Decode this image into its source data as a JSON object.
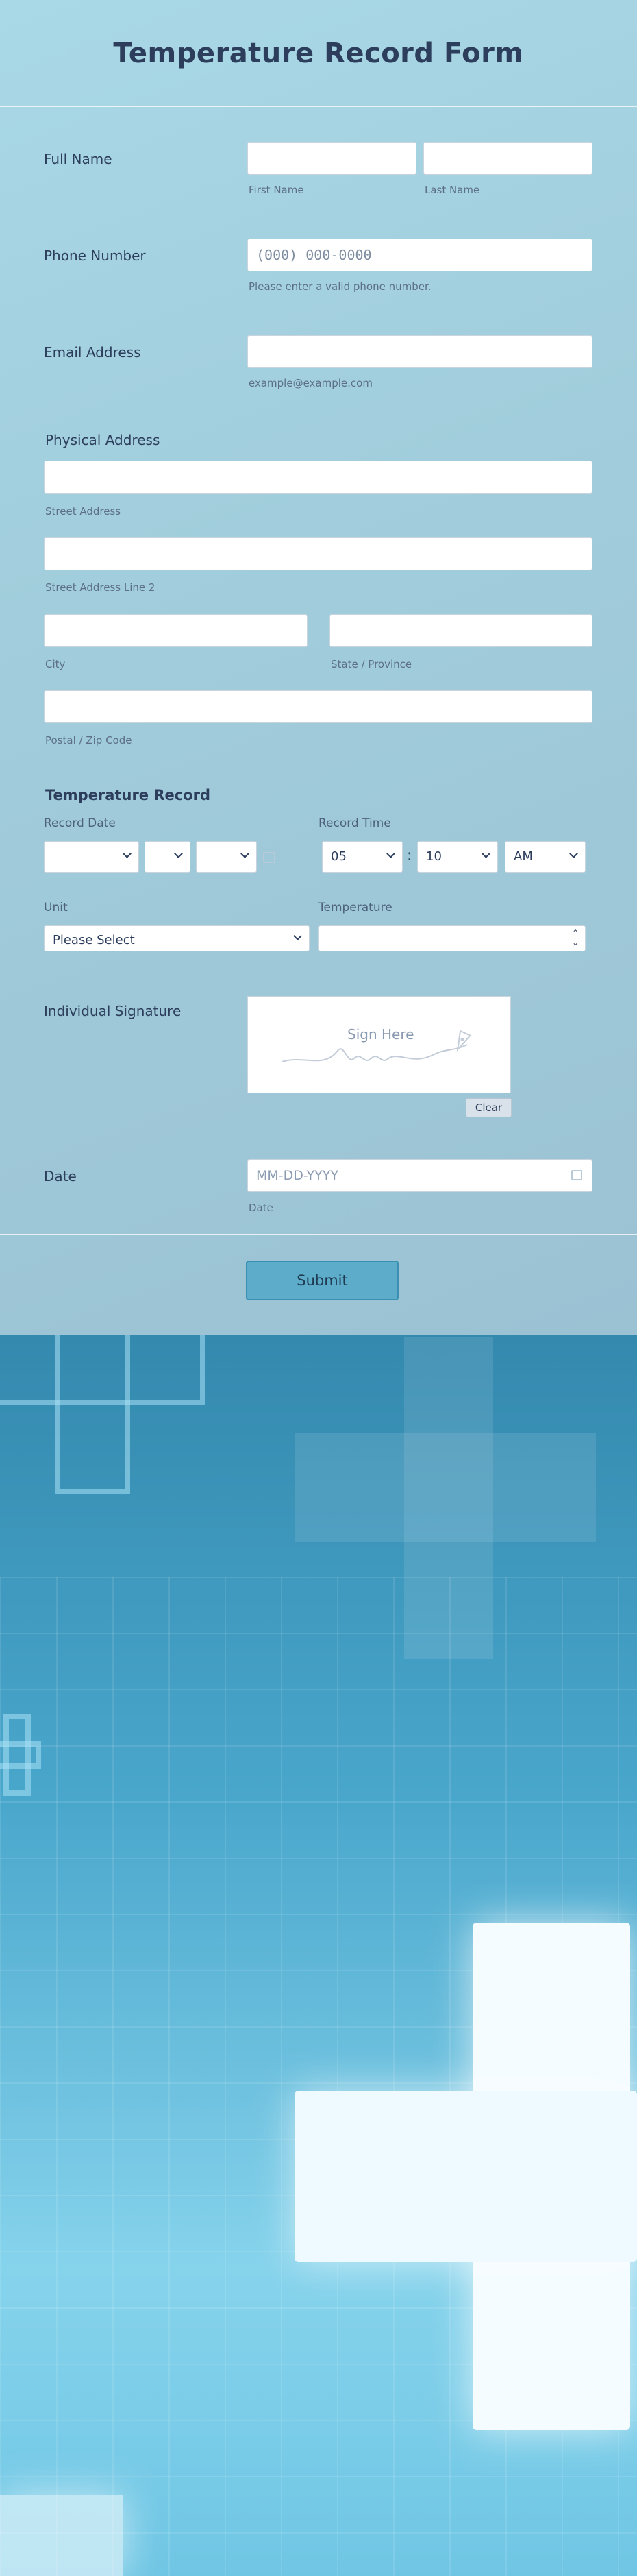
{
  "form": {
    "title": "Temperature Record Form",
    "full_name": {
      "label": "Full Name",
      "first_sublabel": "First Name",
      "last_sublabel": "Last Name",
      "first_value": "",
      "last_value": ""
    },
    "phone": {
      "label": "Phone Number",
      "placeholder": "(000) 000-0000",
      "hint": "Please enter a valid phone number."
    },
    "email": {
      "label": "Email Address",
      "value": "",
      "hint": "example@example.com"
    },
    "address": {
      "title": "Physical Address",
      "street_sublabel": "Street Address",
      "street2_sublabel": "Street Address Line 2",
      "city_sublabel": "City",
      "state_sublabel": "State / Province",
      "zip_sublabel": "Postal / Zip Code"
    },
    "temperature_record": {
      "title": "Temperature Record",
      "date_label": "Record Date",
      "time_label": "Record Time",
      "month_value": "",
      "day_value": "",
      "year_value": "",
      "hour_value": "05",
      "minute_value": "10",
      "ampm_value": "AM",
      "colon": ":",
      "unit_label": "Unit",
      "unit_value": "Please Select",
      "temperature_label": "Temperature",
      "temperature_value": ""
    },
    "signature": {
      "label": "Individual Signature",
      "placeholder": "Sign Here",
      "clear_label": "Clear"
    },
    "date": {
      "label": "Date",
      "placeholder": "MM-DD-YYYY",
      "sublabel": "Date"
    },
    "submit_label": "Submit"
  }
}
